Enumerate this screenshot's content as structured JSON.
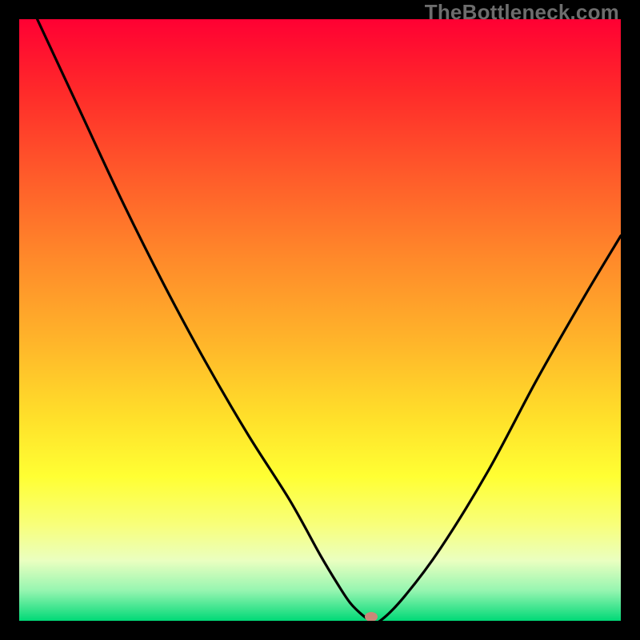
{
  "watermark": "TheBottleneck.com",
  "colors": {
    "frame": "#000000",
    "curve": "#000000",
    "marker": "#c98878",
    "gradient_top": "#ff0033",
    "gradient_mid": "#ffff33",
    "gradient_bottom": "#00d977"
  },
  "chart_data": {
    "type": "line",
    "title": "",
    "xlabel": "",
    "ylabel": "",
    "xlim": [
      0,
      100
    ],
    "ylim": [
      0,
      100
    ],
    "grid": false,
    "legend": false,
    "series": [
      {
        "name": "bottleneck-curve",
        "x": [
          3,
          10,
          17,
          24,
          31,
          38,
          45,
          50,
          53,
          55,
          57,
          58.5,
          60,
          64,
          70,
          78,
          86,
          94,
          100
        ],
        "values": [
          100,
          85,
          70,
          56,
          43,
          31,
          20,
          11,
          6,
          3,
          1,
          0,
          0,
          4,
          12,
          25,
          40,
          54,
          64
        ]
      }
    ],
    "annotations": [
      {
        "type": "marker",
        "x": 58.5,
        "y": 0.6,
        "label": "optimal-point"
      }
    ]
  }
}
